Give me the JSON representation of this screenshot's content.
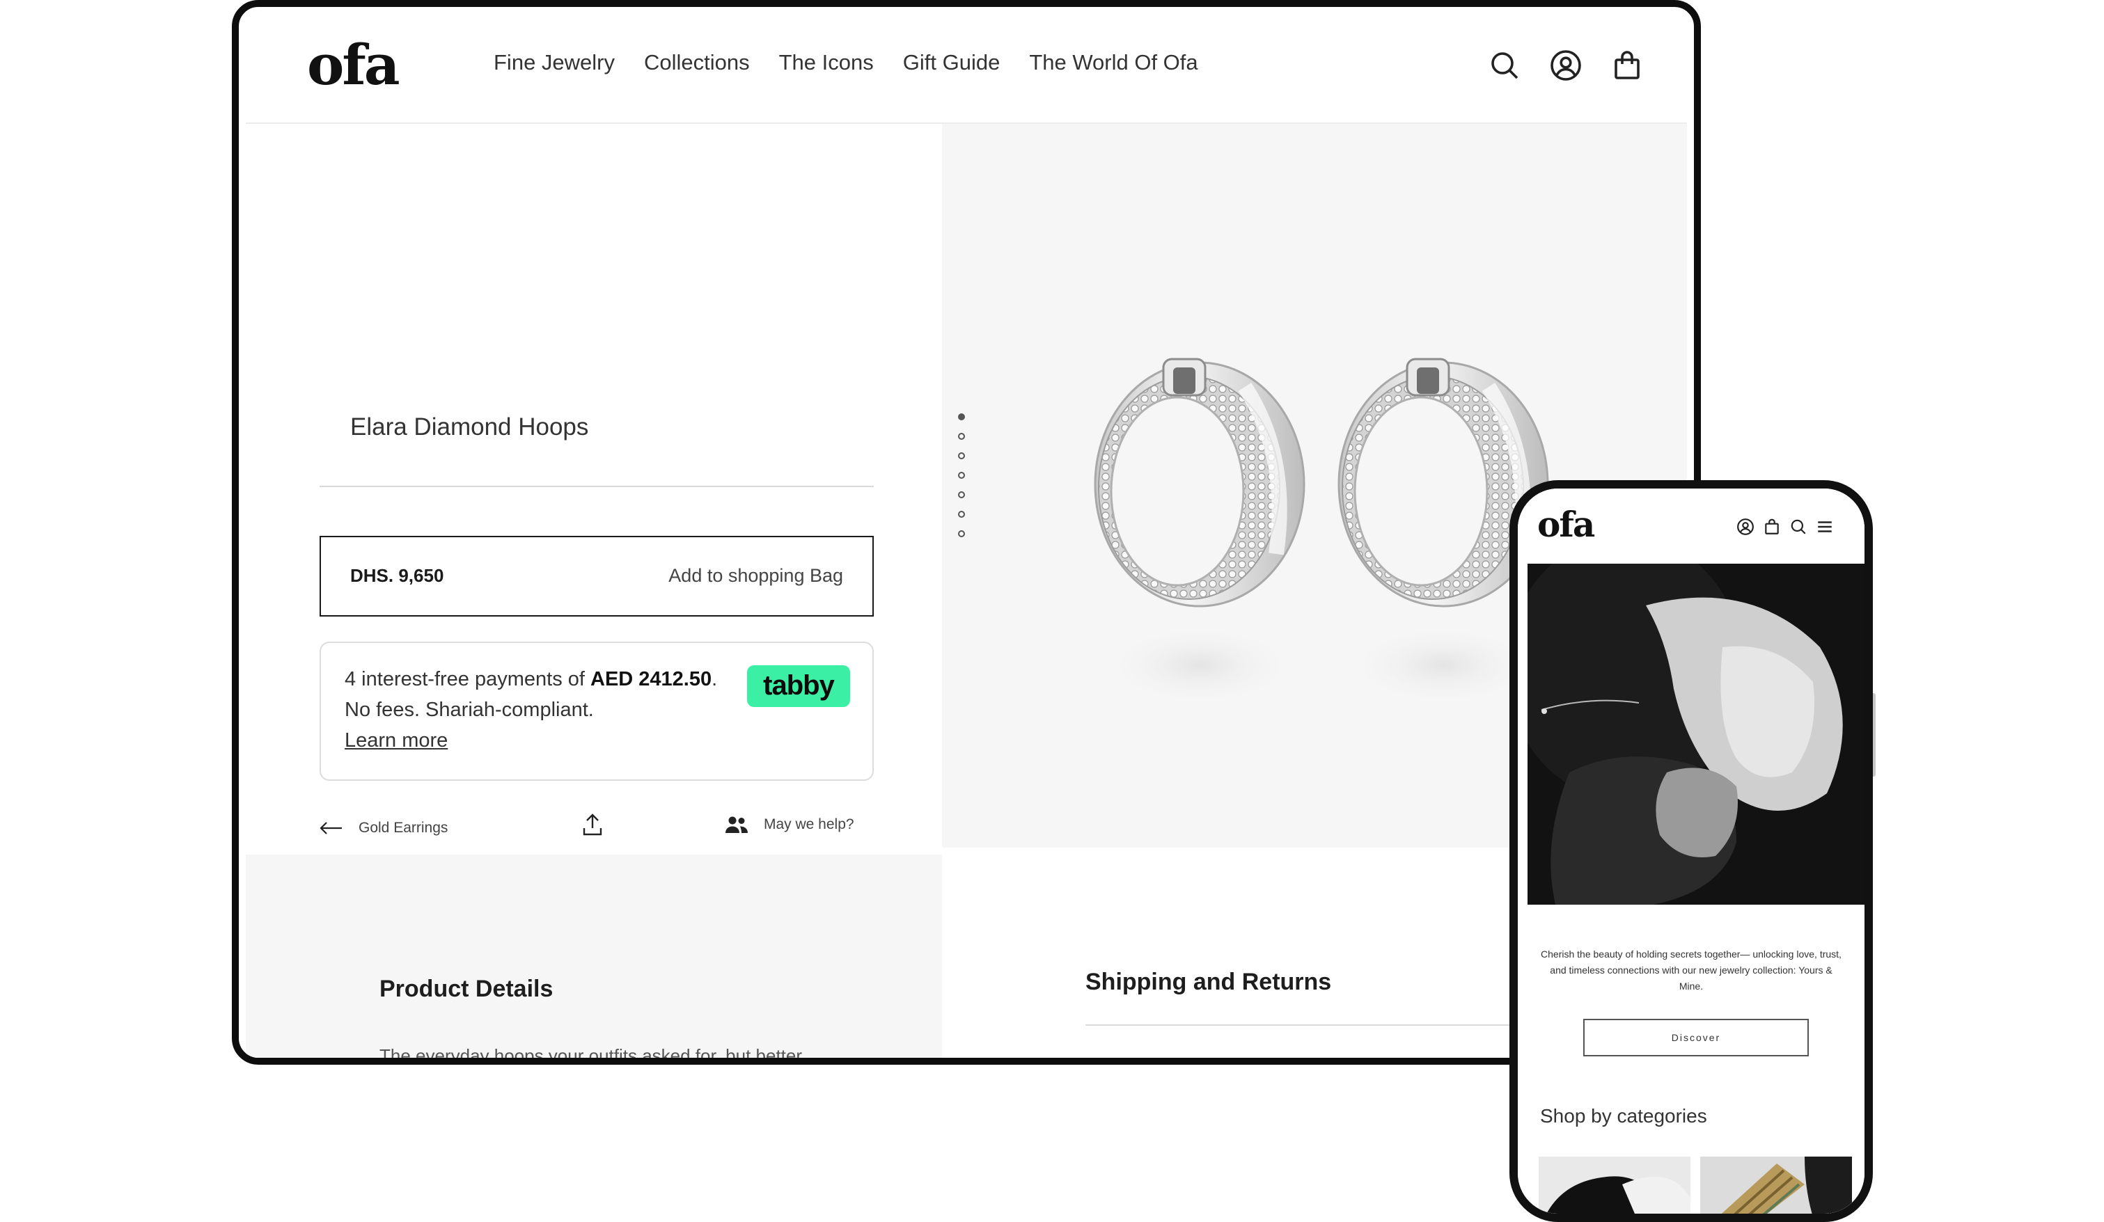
{
  "desktop": {
    "brand": "ofa",
    "nav": [
      "Fine Jewelry",
      "Collections",
      "The Icons",
      "Gift Guide",
      "The World Of Ofa"
    ],
    "header_icons": [
      "search-icon",
      "account-icon",
      "shopping-bag-icon"
    ],
    "product": {
      "title": "Elara Diamond Hoops",
      "price": "DHS. 9,650",
      "add_to_bag": "Add to shopping Bag"
    },
    "tabby": {
      "text_before": "4 interest-free payments of ",
      "amount": "AED 2412.50",
      "text_after": ". No fees. Shariah-compliant.",
      "learn_more": "Learn more",
      "logo": "tabby"
    },
    "actions": {
      "back_label": "Gold Earrings",
      "help_label": "May we help?"
    },
    "gallery": {
      "dots": 7,
      "active_dot": 1
    },
    "sections": {
      "product_details": "Product Details",
      "product_details_text": "The everyday hoops your outfits asked for, but better",
      "shipping_returns": "Shipping and Returns"
    }
  },
  "mobile": {
    "brand": "ofa",
    "header_icons": [
      "account-icon",
      "shopping-bag-icon",
      "search-icon",
      "menu-icon"
    ],
    "hero_caption": "Cherish the beauty of holding secrets together— unlocking love, trust, and timeless connections with our new jewelry collection: Yours & Mine.",
    "discover_label": "Discover",
    "shop_by_categories": "Shop by categories"
  },
  "colors": {
    "tabby_green": "#3bf0a5",
    "panel_gray": "#f6f6f6",
    "frame_black": "#0d0d0d"
  }
}
